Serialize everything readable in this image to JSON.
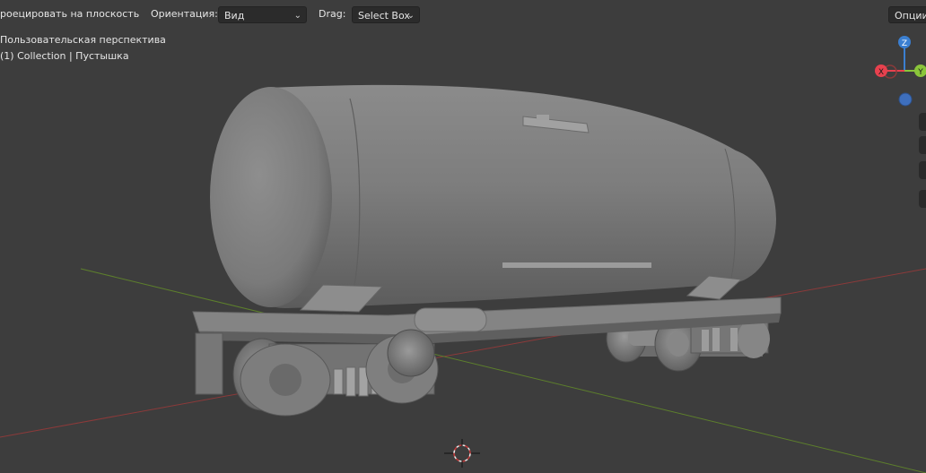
{
  "header": {
    "project_label": "роецировать на плоскость",
    "orientation_label": "Ориентация:",
    "orientation_value": "Вид",
    "drag_label": "Drag:",
    "drag_value": "Select Box",
    "options_label": "Опции"
  },
  "viewport": {
    "perspective_label": "Пользовательская перспектива",
    "collection_label": "(1) Collection | Пустышка"
  },
  "gizmo": {
    "z": "Z",
    "x": "X",
    "y": "Y",
    "colors": {
      "x": "#e8414e",
      "y": "#8ac53a",
      "z": "#3b7fd1",
      "view": "#3e6fbd"
    }
  },
  "icons": {
    "orientation_chevron": "chevron-down-icon",
    "drag_chevron": "chevron-down-icon",
    "cursor": "3d-cursor-icon",
    "model": "tank-wagon-model"
  },
  "colors": {
    "background": "#3d3d3d",
    "model": "#7b7b7b",
    "x_axis": "#8c3a3a",
    "y_axis": "#5d7f2c"
  }
}
